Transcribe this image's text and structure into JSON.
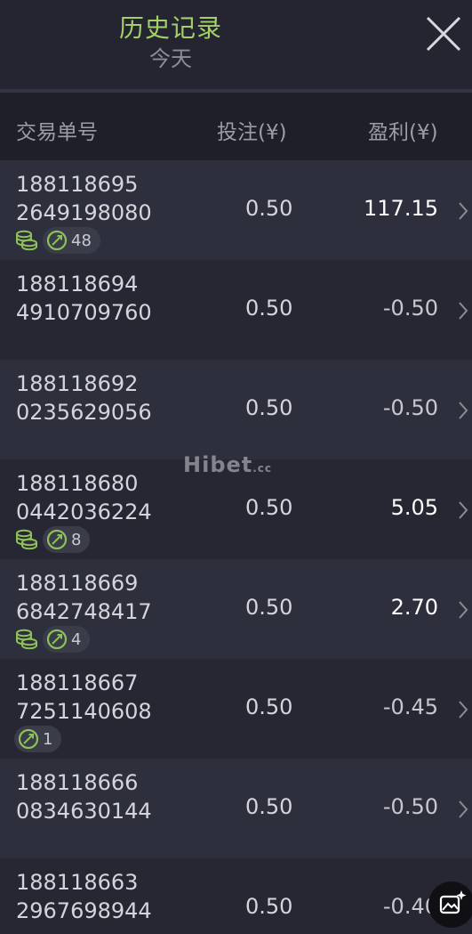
{
  "header": {
    "title": "历史记录",
    "subtitle": "今天"
  },
  "columns": {
    "order_no": "交易单号",
    "bet": "投注(¥)",
    "profit": "盈利(¥)"
  },
  "rows": [
    {
      "id_line1": "188118695",
      "id_line2": "2649198080",
      "bet": "0.50",
      "profit": "117.15",
      "profit_kind": "win",
      "coins": true,
      "count": "48"
    },
    {
      "id_line1": "188118694",
      "id_line2": "4910709760",
      "bet": "0.50",
      "profit": "-0.50",
      "profit_kind": "lose",
      "coins": false,
      "count": null
    },
    {
      "id_line1": "188118692",
      "id_line2": "0235629056",
      "bet": "0.50",
      "profit": "-0.50",
      "profit_kind": "lose",
      "coins": false,
      "count": null
    },
    {
      "id_line1": "188118680",
      "id_line2": "0442036224",
      "bet": "0.50",
      "profit": "5.05",
      "profit_kind": "win",
      "coins": true,
      "count": "8"
    },
    {
      "id_line1": "188118669",
      "id_line2": "6842748417",
      "bet": "0.50",
      "profit": "2.70",
      "profit_kind": "win",
      "coins": true,
      "count": "4"
    },
    {
      "id_line1": "188118667",
      "id_line2": "7251140608",
      "bet": "0.50",
      "profit": "-0.45",
      "profit_kind": "lose",
      "coins": false,
      "count": "1"
    },
    {
      "id_line1": "188118666",
      "id_line2": "0834630144",
      "bet": "0.50",
      "profit": "-0.50",
      "profit_kind": "lose",
      "coins": false,
      "count": null
    },
    {
      "id_line1": "188118663",
      "id_line2": "2967698944",
      "bet": "0.50",
      "profit": "-0.40",
      "profit_kind": "lose",
      "coins": false,
      "count": null
    }
  ],
  "watermark": {
    "brand": "Hibet",
    "suffix": ".cc"
  },
  "icons": {
    "close": "close-icon",
    "coin": "coin-stack-icon",
    "ball": "soccer-ball-icon",
    "chevron": "chevron-right-icon",
    "fab": "image-sparkle-icon"
  },
  "colors": {
    "title": "#a4d06a",
    "accent": "#8ec15a",
    "background": "#262733"
  }
}
